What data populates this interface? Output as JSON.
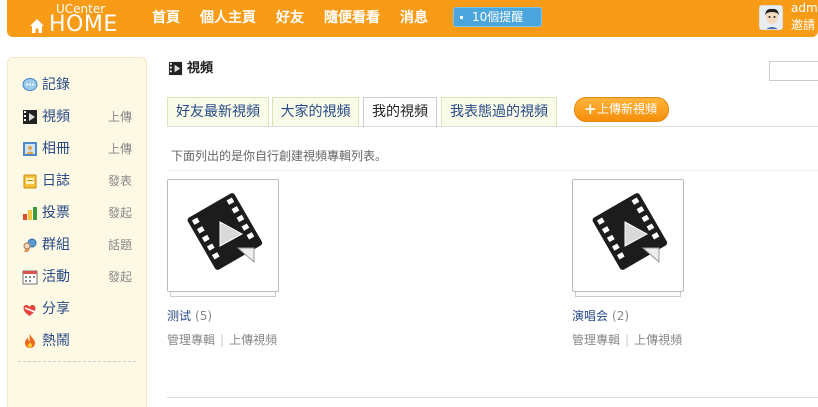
{
  "header": {
    "brand_top": "UCenter",
    "brand_home": "HOME",
    "nav": [
      "首頁",
      "個人主頁",
      "好友",
      "隨便看看",
      "消息"
    ],
    "notice": "10個提醒",
    "user_name": "adm",
    "user_invite": "邀請"
  },
  "sidebar": {
    "items": [
      {
        "label": "記錄",
        "action": "",
        "icon": "record-icon"
      },
      {
        "label": "視頻",
        "action": "上傳",
        "icon": "video-icon"
      },
      {
        "label": "相冊",
        "action": "上傳",
        "icon": "album-icon"
      },
      {
        "label": "日誌",
        "action": "發表",
        "icon": "blog-icon"
      },
      {
        "label": "投票",
        "action": "發起",
        "icon": "poll-icon"
      },
      {
        "label": "群組",
        "action": "話題",
        "icon": "group-icon"
      },
      {
        "label": "活動",
        "action": "發起",
        "icon": "event-icon"
      },
      {
        "label": "分享",
        "action": "",
        "icon": "share-icon"
      },
      {
        "label": "熱鬧",
        "action": "",
        "icon": "hot-icon"
      }
    ]
  },
  "main": {
    "title": "視頻",
    "tabs": [
      "好友最新視頻",
      "大家的視頻",
      "我的視頻",
      "我表態過的視頻"
    ],
    "active_tab": "我的視頻",
    "new_video_button": "上傳新視頻",
    "intro": "下面列出的是你自行創建視頻專輯列表。",
    "albums": [
      {
        "name": "测试",
        "count": "(5)",
        "manage": "管理專輯",
        "upload": "上傳視頻"
      },
      {
        "name": "演唱会",
        "count": "(2)",
        "manage": "管理專輯",
        "upload": "上傳視頻"
      }
    ]
  },
  "colors": {
    "header_orange": "#f89c18",
    "notice_blue": "#4aa6dc",
    "sidebar_bg": "#fdf9e4",
    "link_blue": "#2a4a88",
    "tab_bg": "#f7fbe8"
  }
}
